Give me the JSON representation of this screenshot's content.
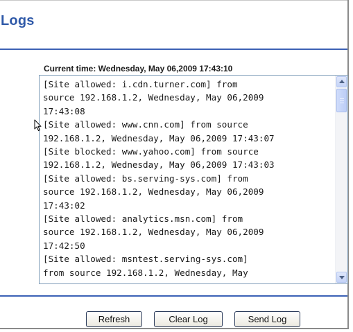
{
  "header": {
    "title": "Logs"
  },
  "status": {
    "current_time": "Current time: Wednesday, May 06,2009 17:43:10"
  },
  "log": {
    "lines": [
      "[Site allowed: i.cdn.turner.com] from",
      "source 192.168.1.2, Wednesday, May 06,2009",
      "17:43:08",
      "[Site allowed: www.cnn.com] from source",
      "192.168.1.2, Wednesday, May 06,2009 17:43:07",
      "[Site blocked: www.yahoo.com] from source",
      "192.168.1.2, Wednesday, May 06,2009 17:43:03",
      "[Site allowed: bs.serving-sys.com] from",
      "source 192.168.1.2, Wednesday, May 06,2009",
      "17:43:02",
      "[Site allowed: analytics.msn.com] from",
      "source 192.168.1.2, Wednesday, May 06,2009",
      "17:42:50",
      "[Site allowed: msntest.serving-sys.com]",
      "from source 192.168.1.2, Wednesday, May"
    ]
  },
  "buttons": {
    "refresh": "Refresh",
    "clear_log": "Clear Log",
    "send_log": "Send Log"
  },
  "colors": {
    "accent": "#2f59a8",
    "rule": "#3c61b5"
  },
  "icons": {
    "scroll_up": "chevron-up-icon",
    "scroll_down": "chevron-down-icon",
    "pointer": "mouse-pointer-icon"
  }
}
